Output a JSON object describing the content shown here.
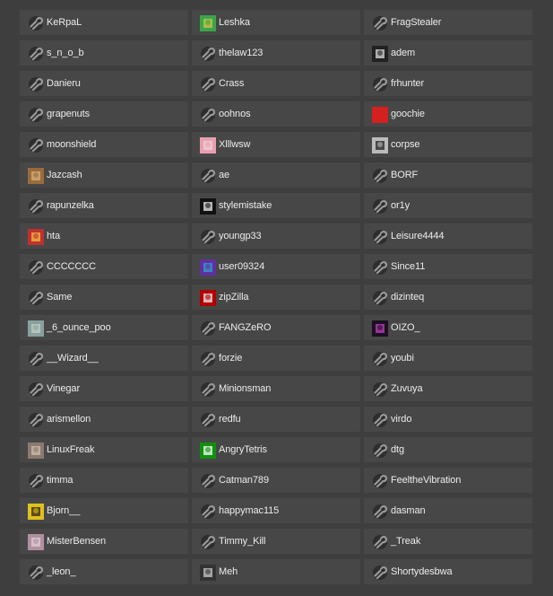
{
  "colors": {
    "background": "#3e3e3e",
    "cell": "#474747",
    "text": "#ececec",
    "default_icon": "#2b2b2b"
  },
  "users": [
    {
      "name": "KeRpaL",
      "avatar": "default-steam-icon"
    },
    {
      "name": "Leshka",
      "avatar": "custom-avatar"
    },
    {
      "name": "FragStealer",
      "avatar": "default-steam-icon"
    },
    {
      "name": "s_n_o_b",
      "avatar": "default-steam-icon"
    },
    {
      "name": "thelaw123",
      "avatar": "default-steam-icon"
    },
    {
      "name": "adem",
      "avatar": "custom-avatar"
    },
    {
      "name": "Danieru",
      "avatar": "default-steam-icon"
    },
    {
      "name": "Crass",
      "avatar": "default-steam-icon"
    },
    {
      "name": "frhunter",
      "avatar": "default-steam-icon"
    },
    {
      "name": "grapenuts",
      "avatar": "default-steam-icon"
    },
    {
      "name": "oohnos",
      "avatar": "default-steam-icon"
    },
    {
      "name": "goochie",
      "avatar": "custom-avatar"
    },
    {
      "name": "moonshield",
      "avatar": "default-steam-icon"
    },
    {
      "name": "Xlllwsw",
      "avatar": "custom-avatar"
    },
    {
      "name": "corpse",
      "avatar": "custom-avatar"
    },
    {
      "name": "Jazcash",
      "avatar": "custom-avatar"
    },
    {
      "name": "ae",
      "avatar": "default-steam-icon"
    },
    {
      "name": "BORF",
      "avatar": "default-steam-icon"
    },
    {
      "name": "rapunzelka",
      "avatar": "default-steam-icon"
    },
    {
      "name": "stylemistake",
      "avatar": "custom-avatar"
    },
    {
      "name": "or1y",
      "avatar": "default-steam-icon"
    },
    {
      "name": "hta",
      "avatar": "custom-avatar"
    },
    {
      "name": "youngp33",
      "avatar": "default-steam-icon"
    },
    {
      "name": "Leisure4444",
      "avatar": "default-steam-icon"
    },
    {
      "name": "CCCCCCC",
      "avatar": "default-steam-icon"
    },
    {
      "name": "user09324",
      "avatar": "custom-avatar"
    },
    {
      "name": "Since11",
      "avatar": "default-steam-icon"
    },
    {
      "name": "Same",
      "avatar": "default-steam-icon"
    },
    {
      "name": "zipZilla",
      "avatar": "custom-avatar"
    },
    {
      "name": "dizinteq",
      "avatar": "default-steam-icon"
    },
    {
      "name": "_6_ounce_poo",
      "avatar": "custom-avatar"
    },
    {
      "name": "FANGZeRO",
      "avatar": "default-steam-icon"
    },
    {
      "name": "OIZO_",
      "avatar": "custom-avatar"
    },
    {
      "name": "__Wizard__",
      "avatar": "default-steam-icon"
    },
    {
      "name": "forzie",
      "avatar": "default-steam-icon"
    },
    {
      "name": "youbi",
      "avatar": "default-steam-icon"
    },
    {
      "name": "Vinegar",
      "avatar": "default-steam-icon"
    },
    {
      "name": "Minionsman",
      "avatar": "default-steam-icon"
    },
    {
      "name": "Zuvuya",
      "avatar": "default-steam-icon"
    },
    {
      "name": "arismellon",
      "avatar": "default-steam-icon"
    },
    {
      "name": "redfu",
      "avatar": "default-steam-icon"
    },
    {
      "name": "virdo",
      "avatar": "default-steam-icon"
    },
    {
      "name": "LinuxFreak",
      "avatar": "custom-avatar"
    },
    {
      "name": "AngryTetris",
      "avatar": "custom-avatar"
    },
    {
      "name": "dtg",
      "avatar": "default-steam-icon"
    },
    {
      "name": "timma",
      "avatar": "default-steam-icon"
    },
    {
      "name": "Catman789",
      "avatar": "default-steam-icon"
    },
    {
      "name": "FeeltheVibration",
      "avatar": "default-steam-icon"
    },
    {
      "name": "Bjorn__",
      "avatar": "custom-avatar"
    },
    {
      "name": "happymac115",
      "avatar": "default-steam-icon"
    },
    {
      "name": "dasman",
      "avatar": "default-steam-icon"
    },
    {
      "name": "MisterBensen",
      "avatar": "custom-avatar"
    },
    {
      "name": "Timmy_Kill",
      "avatar": "default-steam-icon"
    },
    {
      "name": "_Treak",
      "avatar": "default-steam-icon"
    },
    {
      "name": "_leon_",
      "avatar": "default-steam-icon"
    },
    {
      "name": "Meh",
      "avatar": "custom-avatar"
    },
    {
      "name": "Shortydesbwa",
      "avatar": "default-steam-icon"
    }
  ]
}
